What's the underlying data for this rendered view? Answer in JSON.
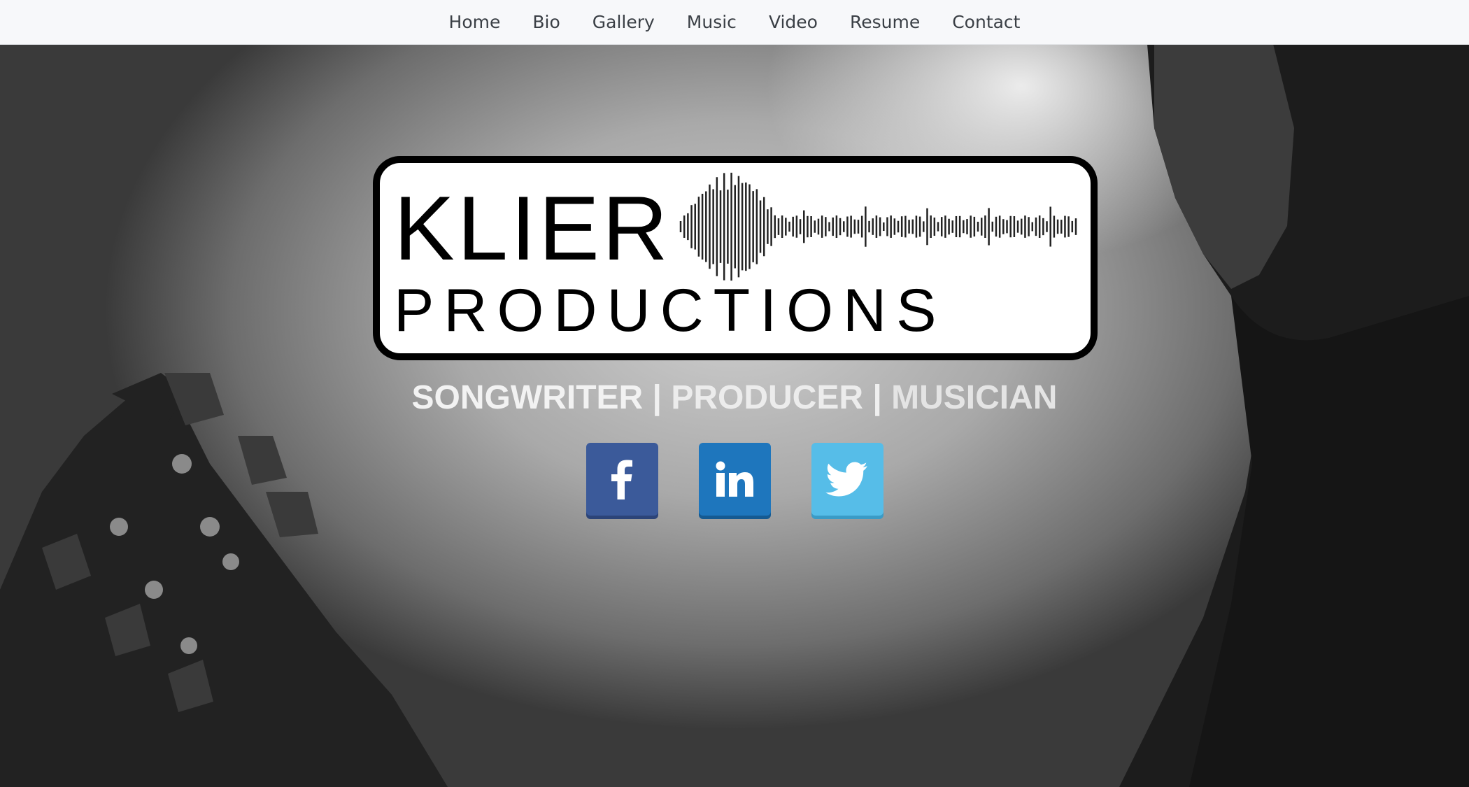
{
  "nav": {
    "items": [
      {
        "label": "Home"
      },
      {
        "label": "Bio"
      },
      {
        "label": "Gallery"
      },
      {
        "label": "Music"
      },
      {
        "label": "Video"
      },
      {
        "label": "Resume"
      },
      {
        "label": "Contact"
      }
    ]
  },
  "hero": {
    "logo": {
      "line1": "KLIER",
      "line2": "PRODUCTIONS"
    },
    "tagline": {
      "part1": "SONGWRITER",
      "sep": "|",
      "part2": "PRODUCER",
      "part3": "MUSICIAN"
    },
    "socials": [
      {
        "icon": "facebook-icon",
        "color": "#3b5a9a"
      },
      {
        "icon": "linkedin-icon",
        "color": "#1e76bd"
      },
      {
        "icon": "twitter-icon",
        "color": "#56bde8"
      }
    ]
  }
}
